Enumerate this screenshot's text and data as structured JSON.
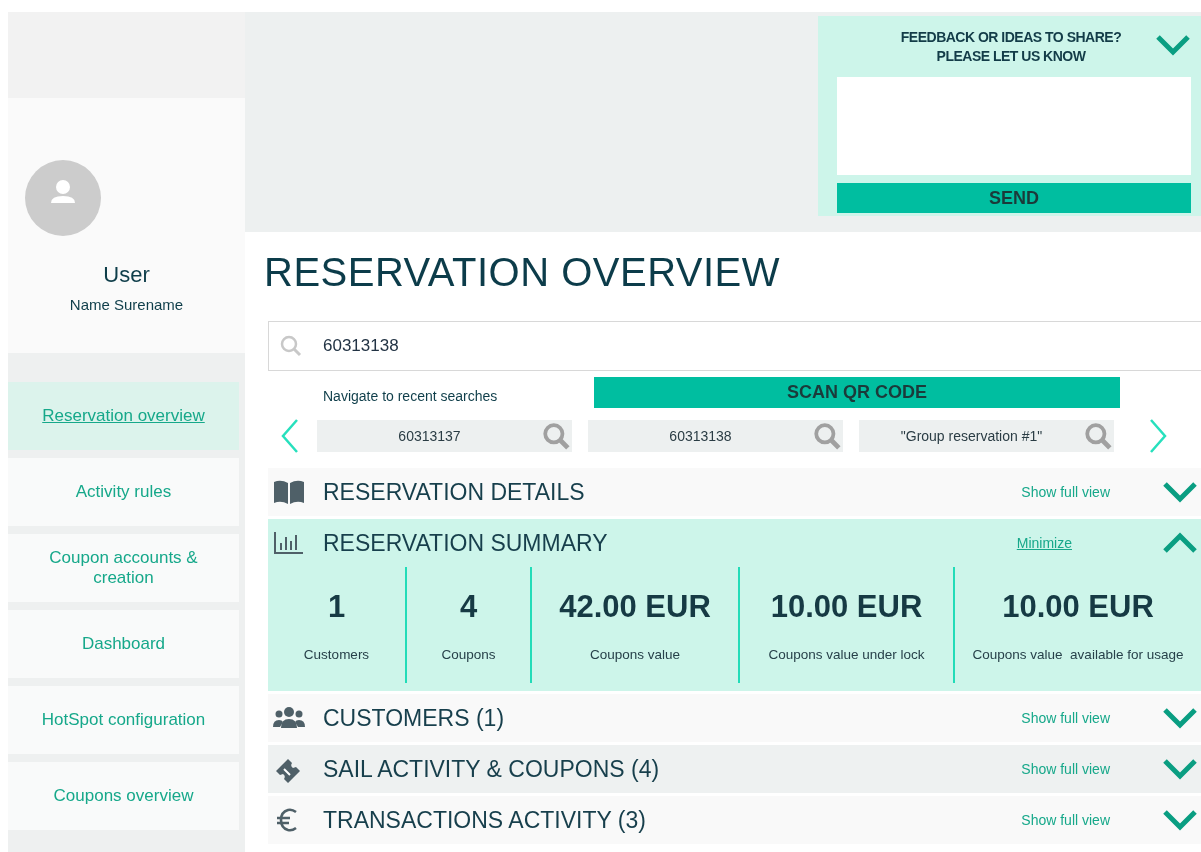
{
  "feedback": {
    "title": "FEEDBACK OR IDEAS TO SHARE?",
    "subtitle": "PLEASE LET US KNOW",
    "expanded": true,
    "send": "SEND"
  },
  "user": {
    "role": "User",
    "name": "Name Surename"
  },
  "nav": [
    {
      "label": "Reservation overview",
      "selected": true
    },
    {
      "label": "Activity rules",
      "selected": false
    },
    {
      "label": "Coupon accounts & creation",
      "selected": false
    },
    {
      "label": "Dashboard",
      "selected": false
    },
    {
      "label": "HotSpot configuration",
      "selected": false
    },
    {
      "label": "Coupons overview",
      "selected": false
    }
  ],
  "title": "RESERVATION OVERVIEW",
  "search": {
    "value": "60313138"
  },
  "recent": {
    "label": "Navigate to recent searches",
    "scan": "SCAN QR CODE",
    "items": [
      "60313137",
      "60313138",
      "\"Group reservation #1\""
    ]
  },
  "sections": [
    {
      "kind": "book",
      "title": "RESERVATION DETAILS",
      "link": "Show full view",
      "expanded": false
    },
    {
      "kind": "chart",
      "title": "RESERVATION SUMMARY",
      "link": "Minimize",
      "expanded": true,
      "stats": [
        {
          "value": "1",
          "label": "Customers"
        },
        {
          "value": "4",
          "label": "Coupons"
        },
        {
          "value": "42.00 EUR",
          "label": "Coupons value"
        },
        {
          "value": "10.00 EUR",
          "label": "Coupons value under lock"
        },
        {
          "value": "10.00 EUR",
          "label": "Coupons value  available for usage"
        }
      ]
    },
    {
      "kind": "people",
      "title": "CUSTOMERS (1)",
      "link": "Show full view",
      "expanded": false
    },
    {
      "kind": "ticket",
      "title": "SAIL ACTIVITY & COUPONS (4)",
      "link": "Show full view",
      "expanded": false
    },
    {
      "kind": "euro",
      "title": "TRANSACTIONS ACTIVITY (3)",
      "link": "Show full view",
      "expanded": false
    }
  ]
}
